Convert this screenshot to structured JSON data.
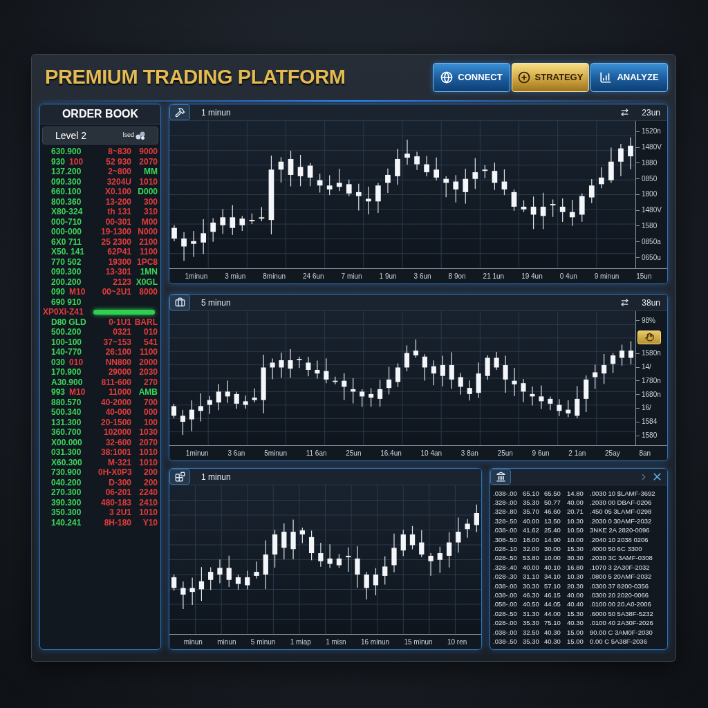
{
  "header": {
    "title": "PREMIUM TRADING PLATFORM",
    "buttons": [
      {
        "label": "CONNECT",
        "selected": false
      },
      {
        "label": "STRATEGY",
        "selected": true
      },
      {
        "label": "ANALYZE",
        "selected": false
      }
    ]
  },
  "order_book": {
    "title": "ORDER BOOK",
    "level": "Level 2",
    "level_note": "lsed",
    "rows": [
      {
        "kind": "quote",
        "price": [
          {
            "text": "630.900",
            "color": "#3cd65a"
          }
        ],
        "size": {
          "text": "8~830",
          "color": "#e23c3c"
        },
        "total": {
          "text": "9000",
          "color": "#e23c3c"
        }
      },
      {
        "kind": "quote",
        "price": [
          {
            "text": "930",
            "color": "#3cd65a"
          },
          {
            "text": "100",
            "color": "#e23c3c"
          }
        ],
        "size": {
          "text": "52 930",
          "color": "#e23c3c"
        },
        "total": {
          "text": "2070",
          "color": "#e23c3c"
        }
      },
      {
        "kind": "quote",
        "price": [
          {
            "text": "137.200",
            "color": "#3cd65a"
          }
        ],
        "size": {
          "text": "2~800",
          "color": "#e23c3c"
        },
        "total": {
          "text": "MM",
          "color": "#3cd65a"
        }
      },
      {
        "kind": "quote",
        "price": [
          {
            "text": "090.300",
            "color": "#3cd65a"
          }
        ],
        "size": {
          "text": "3204U",
          "color": "#e23c3c"
        },
        "total": {
          "text": "1010",
          "color": "#e23c3c"
        }
      },
      {
        "kind": "quote",
        "price": [
          {
            "text": "660.100",
            "color": "#3cd65a"
          }
        ],
        "size": {
          "text": "X0.100",
          "color": "#e23c3c"
        },
        "total": {
          "text": "D000",
          "color": "#3cd65a"
        }
      },
      {
        "kind": "quote",
        "price": [
          {
            "text": "800.360",
            "color": "#3cd65a"
          }
        ],
        "size": {
          "text": "13-200",
          "color": "#e23c3c"
        },
        "total": {
          "text": "300",
          "color": "#e23c3c"
        }
      },
      {
        "kind": "quote",
        "price": [
          {
            "text": "X80-324",
            "color": "#3cd65a"
          }
        ],
        "size": {
          "text": "th 131",
          "color": "#e23c3c"
        },
        "total": {
          "text": "310",
          "color": "#e23c3c"
        }
      },
      {
        "kind": "quote",
        "price": [
          {
            "text": "000-710",
            "color": "#3cd65a"
          }
        ],
        "size": {
          "text": "00-301",
          "color": "#e23c3c"
        },
        "total": {
          "text": "M00",
          "color": "#e23c3c"
        }
      },
      {
        "kind": "quote",
        "price": [
          {
            "text": "000-000",
            "color": "#3cd65a"
          }
        ],
        "size": {
          "text": "19-1300",
          "color": "#e23c3c"
        },
        "total": {
          "text": "N000",
          "color": "#e23c3c"
        }
      },
      {
        "kind": "quote",
        "price": [
          {
            "text": "6X0 711",
            "color": "#3cd65a"
          }
        ],
        "size": {
          "text": "25 2300",
          "color": "#e23c3c"
        },
        "total": {
          "text": "2100",
          "color": "#e23c3c"
        }
      },
      {
        "kind": "quote",
        "price": [
          {
            "text": "X50. 141",
            "color": "#3cd65a"
          }
        ],
        "size": {
          "text": "62P41",
          "color": "#e23c3c"
        },
        "total": {
          "text": "1100",
          "color": "#e23c3c"
        }
      },
      {
        "kind": "quote",
        "price": [
          {
            "text": "770 502",
            "color": "#3cd65a"
          }
        ],
        "size": {
          "text": "19300",
          "color": "#e23c3c"
        },
        "total": {
          "text": "1PC8",
          "color": "#e23c3c"
        }
      },
      {
        "kind": "quote",
        "price": [
          {
            "text": "090.300",
            "color": "#3cd65a"
          }
        ],
        "size": {
          "text": "13-301",
          "color": "#e23c3c"
        },
        "total": {
          "text": "1MN",
          "color": "#3cd65a"
        }
      },
      {
        "kind": "quote",
        "price": [
          {
            "text": "200.200",
            "color": "#3cd65a"
          }
        ],
        "size": {
          "text": "2123",
          "color": "#e23c3c"
        },
        "total": {
          "text": "X0GL",
          "color": "#3cd65a"
        }
      },
      {
        "kind": "quote",
        "price": [
          {
            "text": "090",
            "color": "#3cd65a"
          },
          {
            "text": "M10",
            "color": "#e23c3c"
          }
        ],
        "size": {
          "text": "00~2U1",
          "color": "#e23c3c"
        },
        "total": {
          "text": "8000",
          "color": "#e23c3c"
        }
      },
      {
        "kind": "quote",
        "price": [
          {
            "text": "690 910",
            "color": "#3cd65a"
          }
        ]
      },
      {
        "kind": "spread",
        "text": "XP0XI-Z41",
        "color": "#e23c3c"
      },
      {
        "kind": "quote",
        "price": [
          {
            "text": "D80 GLD",
            "color": "#3cd65a"
          }
        ],
        "size": {
          "text": "0·1U1",
          "color": "#e23c3c"
        },
        "total": {
          "text": "BARL",
          "color": "#e23c3c"
        }
      },
      {
        "kind": "quote",
        "price": [
          {
            "text": "500.200",
            "color": "#3cd65a"
          }
        ],
        "size": {
          "text": "0321",
          "color": "#e23c3c"
        },
        "total": {
          "text": "010",
          "color": "#e23c3c"
        }
      },
      {
        "kind": "quote",
        "price": [
          {
            "text": "100-100",
            "color": "#3cd65a"
          }
        ],
        "size": {
          "text": "37~153",
          "color": "#e23c3c"
        },
        "total": {
          "text": "541",
          "color": "#e23c3c"
        }
      },
      {
        "kind": "quote",
        "price": [
          {
            "text": "140-770",
            "color": "#3cd65a"
          }
        ],
        "size": {
          "text": "26:100",
          "color": "#e23c3c"
        },
        "total": {
          "text": "1100",
          "color": "#e23c3c"
        }
      },
      {
        "kind": "quote",
        "price": [
          {
            "text": "030",
            "color": "#3cd65a"
          },
          {
            "text": "010",
            "color": "#e23c3c"
          }
        ],
        "size": {
          "text": "NN800",
          "color": "#e23c3c"
        },
        "total": {
          "text": "2000",
          "color": "#e23c3c"
        }
      },
      {
        "kind": "quote",
        "price": [
          {
            "text": "170.900",
            "color": "#3cd65a"
          }
        ],
        "size": {
          "text": "29000",
          "color": "#e23c3c"
        },
        "total": {
          "text": "2030",
          "color": "#e23c3c"
        }
      },
      {
        "kind": "quote",
        "price": [
          {
            "text": "A30.900",
            "color": "#3cd65a"
          }
        ],
        "size": {
          "text": "811-600",
          "color": "#e23c3c"
        },
        "total": {
          "text": "270",
          "color": "#e23c3c"
        }
      },
      {
        "kind": "quote",
        "price": [
          {
            "text": "993",
            "color": "#3cd65a"
          },
          {
            "text": "M10",
            "color": "#e23c3c"
          }
        ],
        "size": {
          "text": "11000",
          "color": "#e23c3c"
        },
        "total": {
          "text": "AMB",
          "color": "#3cd65a"
        }
      },
      {
        "kind": "quote",
        "price": [
          {
            "text": "880.570",
            "color": "#3cd65a"
          }
        ],
        "size": {
          "text": "40-2000",
          "color": "#e23c3c"
        },
        "total": {
          "text": "700",
          "color": "#e23c3c"
        }
      },
      {
        "kind": "quote",
        "price": [
          {
            "text": "500.340",
            "color": "#3cd65a"
          }
        ],
        "size": {
          "text": "40-000",
          "color": "#e23c3c"
        },
        "total": {
          "text": "000",
          "color": "#e23c3c"
        }
      },
      {
        "kind": "quote",
        "price": [
          {
            "text": "131.300",
            "color": "#3cd65a"
          }
        ],
        "size": {
          "text": "20-1500",
          "color": "#e23c3c"
        },
        "total": {
          "text": "100",
          "color": "#e23c3c"
        }
      },
      {
        "kind": "quote",
        "price": [
          {
            "text": "360.700",
            "color": "#3cd65a"
          }
        ],
        "size": {
          "text": "102000",
          "color": "#e23c3c"
        },
        "total": {
          "text": "1030",
          "color": "#e23c3c"
        }
      },
      {
        "kind": "quote",
        "price": [
          {
            "text": "X00.000",
            "color": "#3cd65a"
          }
        ],
        "size": {
          "text": "32-600",
          "color": "#e23c3c"
        },
        "total": {
          "text": "2070",
          "color": "#e23c3c"
        }
      },
      {
        "kind": "quote",
        "price": [
          {
            "text": "031.300",
            "color": "#3cd65a"
          }
        ],
        "size": {
          "text": "38:1001",
          "color": "#e23c3c"
        },
        "total": {
          "text": "1010",
          "color": "#e23c3c"
        }
      },
      {
        "kind": "quote",
        "price": [
          {
            "text": "X60.300",
            "color": "#3cd65a"
          }
        ],
        "size": {
          "text": "M-321",
          "color": "#e23c3c"
        },
        "total": {
          "text": "1010",
          "color": "#e23c3c"
        }
      },
      {
        "kind": "quote",
        "price": [
          {
            "text": "730.900",
            "color": "#3cd65a"
          }
        ],
        "size": {
          "text": "0H-X0P3",
          "color": "#e23c3c"
        },
        "total": {
          "text": "200",
          "color": "#e23c3c"
        }
      },
      {
        "kind": "quote",
        "price": [
          {
            "text": "040.200",
            "color": "#3cd65a"
          }
        ],
        "size": {
          "text": "D-300",
          "color": "#e23c3c"
        },
        "total": {
          "text": "200",
          "color": "#e23c3c"
        }
      },
      {
        "kind": "quote",
        "price": [
          {
            "text": "270.300",
            "color": "#3cd65a"
          }
        ],
        "size": {
          "text": "06-201",
          "color": "#e23c3c"
        },
        "total": {
          "text": "2240",
          "color": "#e23c3c"
        }
      },
      {
        "kind": "quote",
        "price": [
          {
            "text": "390.300",
            "color": "#3cd65a"
          }
        ],
        "size": {
          "text": "480-183",
          "color": "#e23c3c"
        },
        "total": {
          "text": "2410",
          "color": "#e23c3c"
        }
      },
      {
        "kind": "quote",
        "price": [
          {
            "text": "350.300",
            "color": "#3cd65a"
          }
        ],
        "size": {
          "text": "3 2U1",
          "color": "#e23c3c"
        },
        "total": {
          "text": "1010",
          "color": "#e23c3c"
        }
      },
      {
        "kind": "quote",
        "price": [
          {
            "text": "140.241",
            "color": "#3cd65a"
          }
        ],
        "size": {
          "text": "8H-180",
          "color": "#e23c3c"
        },
        "total": {
          "text": "Y10",
          "color": "#e23c3c"
        }
      }
    ]
  },
  "charts": [
    {
      "timeframe": "1 minun",
      "corner": "23un",
      "y_ticks": [
        "1520n",
        "1480V",
        "1880",
        "0850",
        "1800",
        "1480V",
        "1580",
        "0850a",
        "0650u"
      ],
      "x_ticks": [
        "1minun",
        "3 miun",
        "8minun",
        "24 6un",
        "7 miun",
        "1 9un",
        "3 6un",
        "8 9on",
        "21 1un",
        "19 4un",
        "0 4un",
        "9 minun",
        "15un"
      ]
    },
    {
      "timeframe": "5 minun",
      "corner": "38un",
      "y_ticks": [
        "98%",
        "1580n",
        "14/",
        "1780n",
        "1680n",
        "16/",
        "1584",
        "1580"
      ],
      "x_ticks": [
        "1minun",
        "3 6an",
        "5minun",
        "11 6an",
        "25un",
        "16.4un",
        "10 4an",
        "3 8an",
        "25un",
        "9 6un",
        "2 1an",
        "25ay",
        "8an"
      ]
    },
    {
      "timeframe": "1 minun",
      "x_ticks": [
        "minun",
        "minun",
        "5 minun",
        "1 miap",
        "1 misn",
        "16 minun",
        "15 minun",
        "10 ren"
      ]
    }
  ],
  "table": {
    "rows": [
      [
        ".038-.00",
        "65.10",
        "65.50",
        "14.80",
        ".0030 10 $LAMF-3692"
      ],
      [
        ".328-.00",
        "35.30",
        "50.77",
        "40.00",
        ".2030 00 DBAF-0206"
      ],
      [
        ".328-.80",
        "35.70",
        "46.60",
        "20.71",
        ".450 05 3LAMF-0298"
      ],
      [
        ".328-.50",
        "40.00",
        "13.50",
        "10.30",
        ".2030 0 30AMF-2032"
      ],
      [
        ".038-.00",
        "41.62",
        "25.40",
        "10.50",
        "3NKE 2A 2820-0096"
      ],
      [
        ".308-.50",
        "18.00",
        "14.90",
        "10.00",
        ".2040 10 2038 0206"
      ],
      [
        ".028-.10",
        "32.00",
        "30.00",
        "15.30",
        ".4000 50 6C 3300"
      ],
      [
        ".028-.50",
        "53.80",
        "10.00",
        "30.30",
        ".2030 3C 3AMF-0308"
      ],
      [
        ".328-.40",
        "40.00",
        "40.10",
        "16.80",
        ".1070 3 2A30F-2032"
      ],
      [
        ".028-.30",
        "31.10",
        "34.10",
        "10.30",
        ".0800 5 20AMF-2032"
      ],
      [
        ".038-.00",
        "30.30",
        "57.10",
        "20.30",
        ".0300 37 8200-0356"
      ],
      [
        ".038-.00",
        "46.30",
        "46.15",
        "40.00",
        ".0300 20 2020-0066"
      ],
      [
        ".058-.00",
        "40.50",
        "44.05",
        "40.40",
        ".0100 00 20.A0-2006"
      ],
      [
        ".028-.50",
        "31.30",
        "44.00",
        "15.30",
        ".6000 50 5A38F-5232"
      ],
      [
        ".028-.00",
        "35.30",
        "75.10",
        "40.30",
        ".0100 40 2A30F-2026"
      ],
      [
        ".038-.00",
        "32.50",
        "40.30",
        "15.00",
        "90.00 C 3AM0F-2030"
      ],
      [
        ".038-.50",
        "35.30",
        "40.30",
        "15.00",
        "0.00 C 5A38F-2036"
      ]
    ]
  }
}
